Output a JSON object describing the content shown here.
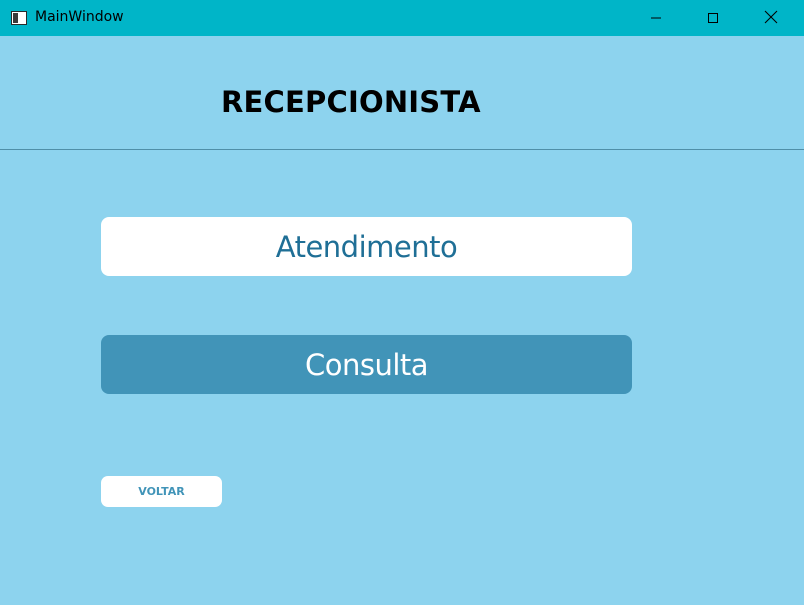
{
  "window": {
    "title": "MainWindow",
    "icon": "app-window-icon",
    "controls": {
      "minimize_icon": "minimize-icon",
      "maximize_icon": "maximize-icon",
      "close_icon": "close-icon"
    }
  },
  "header": {
    "title": "RECEPCIONISTA"
  },
  "main": {
    "buttons": [
      {
        "label": "Atendimento",
        "style": "primary-white"
      },
      {
        "label": "Consulta",
        "style": "filled-blue"
      }
    ],
    "back_button": {
      "label": "VOLTAR"
    }
  },
  "colors": {
    "titlebar": "#00b5c8",
    "background": "#8dd3ee",
    "button_white": "#ffffff",
    "button_blue": "#4194b8",
    "atendimento_text": "#1f6f96"
  }
}
